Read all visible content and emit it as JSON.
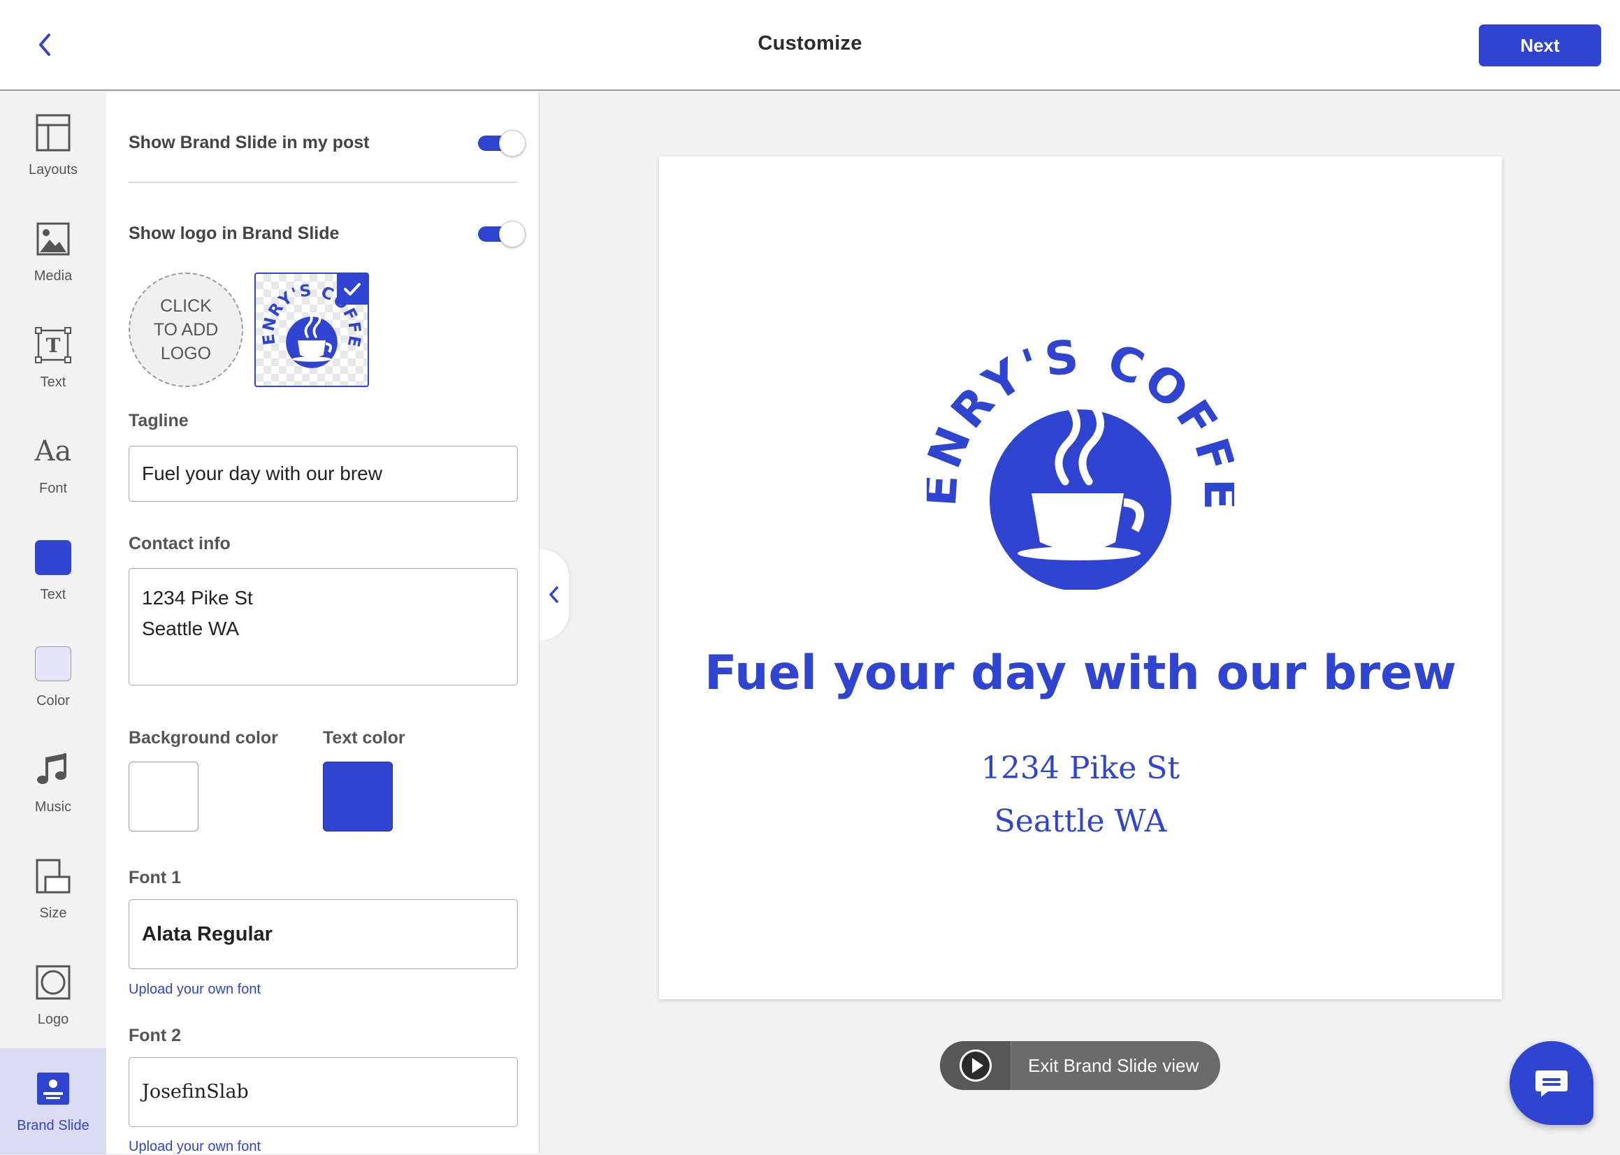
{
  "header": {
    "title": "Customize",
    "next_label": "Next"
  },
  "rail": {
    "items": [
      {
        "label": "Layouts",
        "icon": "layouts-icon"
      },
      {
        "label": "Media",
        "icon": "image-icon"
      },
      {
        "label": "Text",
        "icon": "text-icon"
      },
      {
        "label": "Font",
        "icon": "font-icon"
      },
      {
        "label": "Text",
        "icon": "text-color-swatch",
        "color": "#2f44d0"
      },
      {
        "label": "Color",
        "icon": "color-swatch",
        "color": "#e4e5fb"
      },
      {
        "label": "Music",
        "icon": "music-icon"
      },
      {
        "label": "Size",
        "icon": "size-icon"
      },
      {
        "label": "Logo",
        "icon": "logo-icon"
      },
      {
        "label": "Brand Slide",
        "icon": "brand-slide-icon",
        "active": true
      }
    ]
  },
  "panel": {
    "show_brand_slide_label": "Show Brand Slide in my post",
    "show_brand_slide_on": true,
    "show_logo_label": "Show logo in Brand Slide",
    "show_logo_on": true,
    "add_logo_label": "CLICK TO ADD LOGO",
    "tagline_label": "Tagline",
    "tagline_value": "Fuel your day with our brew",
    "contact_label": "Contact info",
    "contact_value": "1234 Pike St\nSeattle WA",
    "bg_color_label": "Background color",
    "bg_color": "#ffffff",
    "text_color_label": "Text color",
    "text_color": "#2f44d0",
    "font1_label": "Font 1",
    "font1_value": "Alata Regular",
    "font2_label": "Font 2",
    "font2_value": "JosefinSlab",
    "upload_font_label": "Upload your own font"
  },
  "slide": {
    "logo_text": "HENRY'S COFFEE",
    "tagline": "Fuel your day with our brew",
    "contact": "1234 Pike St\nSeattle WA"
  },
  "player": {
    "exit_label": "Exit Brand Slide view"
  },
  "colors": {
    "accent": "#2f44d0"
  }
}
